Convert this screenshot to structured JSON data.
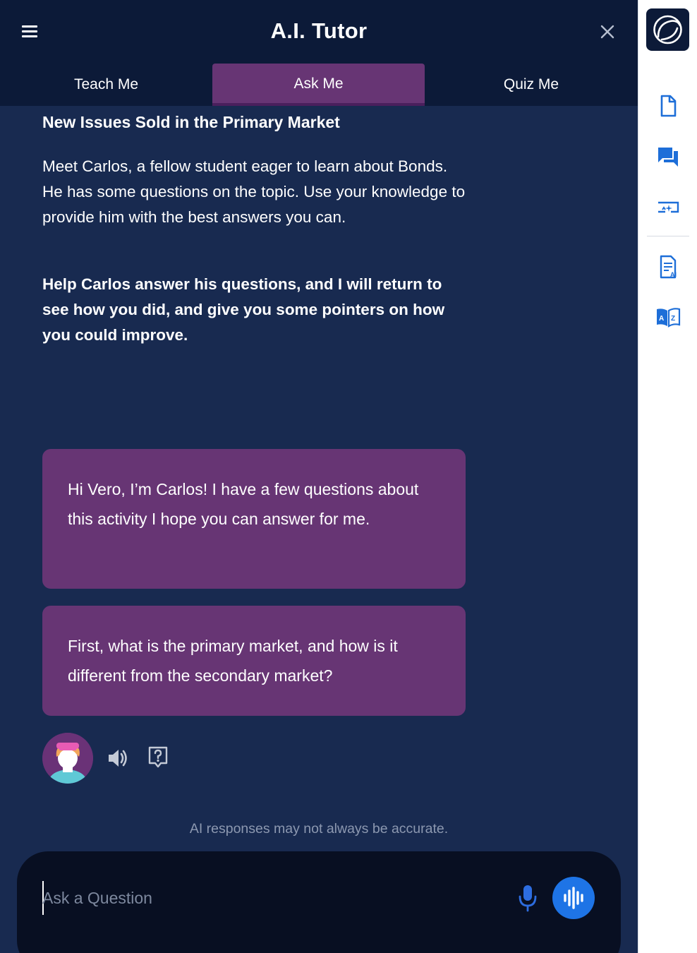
{
  "header": {
    "title": "A.I. Tutor",
    "menu_icon": "hamburger-menu-icon",
    "close_icon": "close-icon"
  },
  "tabs": [
    {
      "label": "Teach Me",
      "active": false
    },
    {
      "label": "Ask Me",
      "active": true
    },
    {
      "label": "Quiz Me",
      "active": false
    }
  ],
  "content": {
    "section_title": "New Issues Sold in the Primary Market",
    "intro": "Meet Carlos, a fellow student eager to learn about Bonds. He has some questions on the topic. Use your knowledge to provide him with the best answers you can.",
    "instruction": "Help Carlos answer his questions, and I will return to see how you did, and give you some pointers on how you could improve."
  },
  "messages": [
    {
      "text": "Hi Vero, I’m Carlos! I have a few questions about this activity I hope you can answer for me."
    },
    {
      "text": "First, what is the primary market, and how is it different from the secondary market?"
    }
  ],
  "message_actions": {
    "avatar": "carlos-avatar",
    "speaker_icon": "speaker-icon",
    "hint_icon": "question-hint-icon"
  },
  "disclaimer": "AI responses may not always be accurate.",
  "input": {
    "placeholder": "Ask a Question",
    "value": "",
    "mic_icon": "microphone-icon",
    "voice_icon": "voice-wave-icon"
  },
  "rail": {
    "items": [
      "app-logo-icon",
      "document-icon",
      "chat-icon",
      "screen-ai-icon",
      "ai-notes-icon",
      "dictionary-icon"
    ]
  },
  "colors": {
    "panel_bg": "#182a50",
    "header_bg": "#0c1a38",
    "bubble_bg": "#673574",
    "accent_blue": "#1e74e6",
    "rail_icon": "#1d6ed8"
  }
}
